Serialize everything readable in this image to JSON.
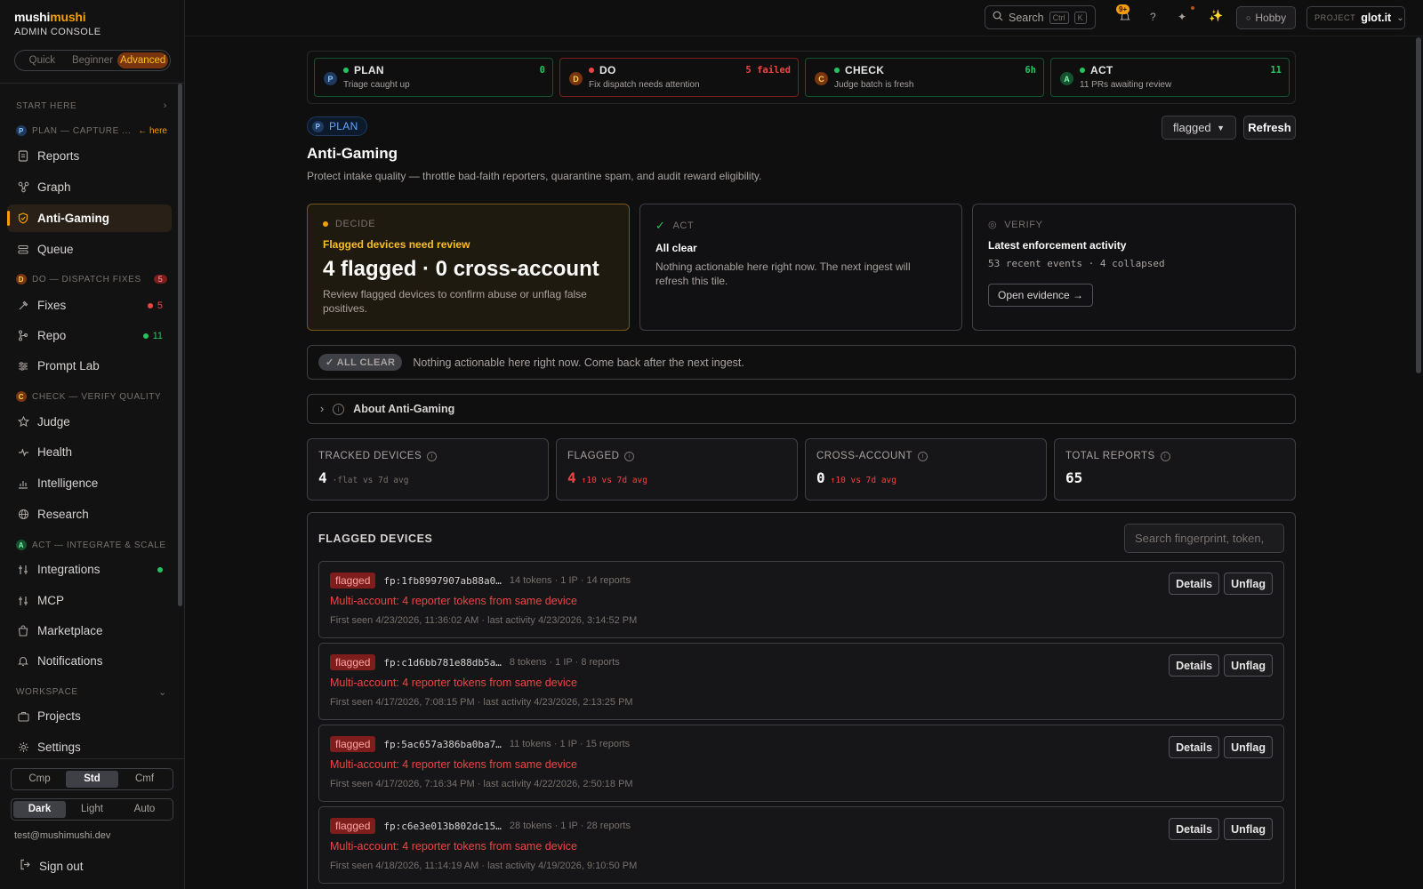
{
  "brand": {
    "name_prefix": "mushi",
    "name_suffix": "mushi",
    "subtitle": "ADMIN CONSOLE"
  },
  "mode": {
    "options": [
      "Quick",
      "Beginner",
      "Advanced"
    ],
    "selected": "Advanced"
  },
  "sidebar": {
    "start_here": "START HERE",
    "plan_section": {
      "letter": "P",
      "label": "PLAN — CAPTURE ...",
      "hint": "← here"
    },
    "plan_items": [
      {
        "label": "Reports",
        "icon": "document-icon"
      },
      {
        "label": "Graph",
        "icon": "graph-icon"
      },
      {
        "label": "Anti-Gaming",
        "icon": "shield-icon",
        "active": true
      },
      {
        "label": "Queue",
        "icon": "queue-icon"
      }
    ],
    "do_section": {
      "letter": "D",
      "label": "DO — DISPATCH FIXES",
      "count": "5"
    },
    "do_items": [
      {
        "label": "Fixes",
        "icon": "wrench-icon",
        "badge": "5",
        "badge_color": "#ef4444"
      },
      {
        "label": "Repo",
        "icon": "git-branch-icon",
        "badge": "11",
        "badge_color": "#22c55e"
      },
      {
        "label": "Prompt Lab",
        "icon": "sliders-icon"
      }
    ],
    "check_section": {
      "letter": "C",
      "label": "CHECK — VERIFY QUALITY"
    },
    "check_items": [
      {
        "label": "Judge",
        "icon": "star-icon"
      },
      {
        "label": "Health",
        "icon": "pulse-icon"
      },
      {
        "label": "Intelligence",
        "icon": "chart-icon"
      },
      {
        "label": "Research",
        "icon": "globe-icon"
      }
    ],
    "act_section": {
      "letter": "A",
      "label": "ACT — INTEGRATE & SCALE"
    },
    "act_items": [
      {
        "label": "Integrations",
        "icon": "plug-icon",
        "dot_color": "#22c55e"
      },
      {
        "label": "MCP",
        "icon": "plug-icon"
      },
      {
        "label": "Marketplace",
        "icon": "bag-icon"
      },
      {
        "label": "Notifications",
        "icon": "bell-icon"
      }
    ],
    "workspace_section": "WORKSPACE",
    "workspace_items": [
      {
        "label": "Projects",
        "icon": "briefcase-icon"
      },
      {
        "label": "Settings",
        "icon": "gear-icon"
      }
    ],
    "density": {
      "options": [
        "Cmp",
        "Std",
        "Cmf"
      ],
      "selected": "Std"
    },
    "theme": {
      "options": [
        "Dark",
        "Light",
        "Auto"
      ],
      "selected": "Dark"
    },
    "user_email": "test@mushimushi.dev",
    "sign_out": "Sign out"
  },
  "topbar": {
    "search_label": "Search",
    "shortcut": [
      "Ctrl",
      "K"
    ],
    "notif_count": "9+",
    "help": "?",
    "plan_badge": "Hobby",
    "project_label": "PROJECT",
    "project_value": "glot.it"
  },
  "pdca": [
    {
      "letter": "P",
      "name": "PLAN",
      "desc": "Triage caught up",
      "stat": "0",
      "color": "#22c55e",
      "letter_bg": "#1e3a5f",
      "letter_fg": "#93c5fd",
      "border": "#14532d"
    },
    {
      "letter": "D",
      "name": "DO",
      "desc": "Fix dispatch needs attention",
      "stat": "5 failed",
      "color": "#ef4444",
      "letter_bg": "#78350f",
      "letter_fg": "#fcd34d",
      "border": "#7f1d1d"
    },
    {
      "letter": "C",
      "name": "CHECK",
      "desc": "Judge batch is fresh",
      "stat": "6h",
      "color": "#22c55e",
      "letter_bg": "#78350f",
      "letter_fg": "#fcd34d",
      "border": "#14532d"
    },
    {
      "letter": "A",
      "name": "ACT",
      "desc": "11 PRs awaiting review",
      "stat": "11",
      "color": "#22c55e",
      "letter_bg": "#14532d",
      "letter_fg": "#86efac",
      "border": "#14532d"
    }
  ],
  "page": {
    "pill_letter": "P",
    "pill_label": "PLAN",
    "title": "Anti-Gaming",
    "description": "Protect intake quality — throttle bad-faith reporters, quarantine spam, and audit reward eligibility.",
    "filter_value": "flagged",
    "refresh_label": "Refresh"
  },
  "tiles": {
    "decide": {
      "kicker": "DECIDE",
      "heading": "Flagged devices need review",
      "big": "4 flagged · 0 cross-account",
      "body": "Review flagged devices to confirm abuse or unflag false positives."
    },
    "act": {
      "kicker": "ACT",
      "heading": "All clear",
      "body": "Nothing actionable here right now. The next ingest will refresh this tile."
    },
    "verify": {
      "kicker": "VERIFY",
      "heading": "Latest enforcement activity",
      "sub": "53 recent events · 4 collapsed",
      "button": "Open evidence →"
    }
  },
  "allclear": {
    "chip": "✓ ALL CLEAR",
    "message": "Nothing actionable here right now. Come back after the next ingest."
  },
  "about": {
    "label": "About Anti-Gaming"
  },
  "metrics": [
    {
      "label": "TRACKED DEVICES",
      "value": "4",
      "delta": "·flat vs 7d avg",
      "color": "#fafaf9",
      "delta_color": "#78716c"
    },
    {
      "label": "FLAGGED",
      "value": "4",
      "delta": "↑10 vs 7d avg",
      "color": "#ef4444",
      "delta_color": "#ef4444"
    },
    {
      "label": "CROSS-ACCOUNT",
      "value": "0",
      "delta": "↑10 vs 7d avg",
      "color": "#fafaf9",
      "delta_color": "#ef4444"
    },
    {
      "label": "TOTAL REPORTS",
      "value": "65",
      "delta": "",
      "color": "#fafaf9",
      "delta_color": "#78716c"
    }
  ],
  "flagged": {
    "title": "FLAGGED DEVICES",
    "search_placeholder": "Search fingerprint, token,",
    "rows": [
      {
        "chip": "flagged",
        "fp": "fp:1fb8997907ab88a0…",
        "meta": "14 tokens · 1 IP · 14 reports",
        "reason": "Multi-account: 4 reporter tokens from same device",
        "seen": "First seen 4/23/2026, 11:36:02 AM · last activity 4/23/2026, 3:14:52 PM"
      },
      {
        "chip": "flagged",
        "fp": "fp:c1d6bb781e88db5a…",
        "meta": "8 tokens · 1 IP · 8 reports",
        "reason": "Multi-account: 4 reporter tokens from same device",
        "seen": "First seen 4/17/2026, 7:08:15 PM · last activity 4/23/2026, 2:13:25 PM"
      },
      {
        "chip": "flagged",
        "fp": "fp:5ac657a386ba0ba7…",
        "meta": "11 tokens · 1 IP · 15 reports",
        "reason": "Multi-account: 4 reporter tokens from same device",
        "seen": "First seen 4/17/2026, 7:16:34 PM · last activity 4/22/2026, 2:50:18 PM"
      },
      {
        "chip": "flagged",
        "fp": "fp:c6e3e013b802dc15…",
        "meta": "28 tokens · 1 IP · 28 reports",
        "reason": "Multi-account: 4 reporter tokens from same device",
        "seen": "First seen 4/18/2026, 11:14:19 AM · last activity 4/19/2026, 9:10:50 PM"
      }
    ],
    "details_label": "Details",
    "unflag_label": "Unflag"
  }
}
